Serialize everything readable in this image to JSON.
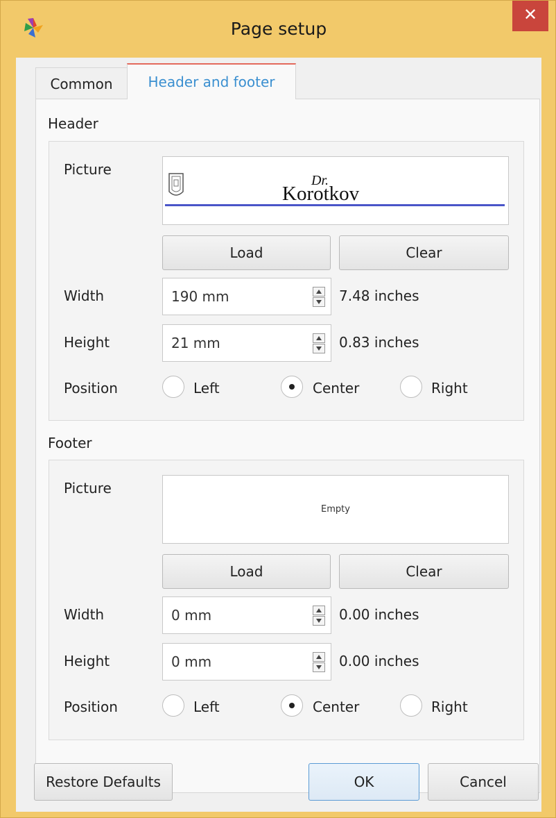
{
  "window": {
    "title": "Page setup",
    "close_glyph": "✕",
    "icons": {
      "app": "app-logo-icon",
      "close": "close-icon"
    }
  },
  "tabs": [
    {
      "label": "Common",
      "active": false
    },
    {
      "label": "Header and footer",
      "active": true
    }
  ],
  "header": {
    "section_title": "Header",
    "picture_label": "Picture",
    "picture_logo_text": "Korotkov",
    "picture_logo_script": "Dr.",
    "load_label": "Load",
    "clear_label": "Clear",
    "width_label": "Width",
    "width_value": "190 mm",
    "width_inches": "7.48 inches",
    "height_label": "Height",
    "height_value": "21 mm",
    "height_inches": "0.83 inches",
    "position_label": "Position",
    "position_options": [
      "Left",
      "Center",
      "Right"
    ],
    "position_selected": "Center"
  },
  "footer": {
    "section_title": "Footer",
    "picture_label": "Picture",
    "picture_empty_text": "Empty",
    "load_label": "Load",
    "clear_label": "Clear",
    "width_label": "Width",
    "width_value": "0 mm",
    "width_inches": "0.00 inches",
    "height_label": "Height",
    "height_value": "0 mm",
    "height_inches": "0.00 inches",
    "position_label": "Position",
    "position_options": [
      "Left",
      "Center",
      "Right"
    ],
    "position_selected": "Center"
  },
  "buttons": {
    "restore_defaults": "Restore Defaults",
    "ok": "OK",
    "cancel": "Cancel"
  },
  "colors": {
    "title_bar": "#f2c96a",
    "close_button": "#c9453c",
    "active_tab_text": "#3a8fd0",
    "logo_line": "#4a55c8"
  }
}
